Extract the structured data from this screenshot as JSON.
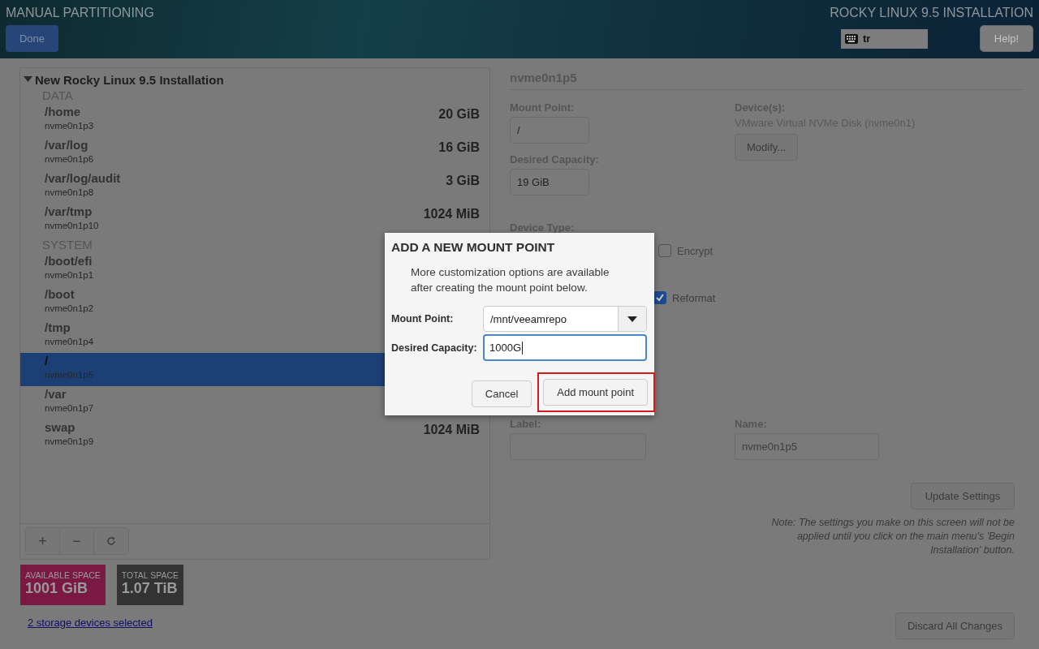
{
  "header": {
    "title": "MANUAL PARTITIONING",
    "done_button": "Done",
    "product": "ROCKY LINUX 9.5 INSTALLATION",
    "keyboard_layout": "tr",
    "help_button": "Help!"
  },
  "partitions": {
    "title": "New Rocky Linux 9.5 Installation",
    "expanded": true,
    "groups": [
      {
        "label": "DATA",
        "items": [
          {
            "mount": "/home",
            "device": "nvme0n1p3",
            "size": "20 GiB",
            "selected": false
          },
          {
            "mount": "/var/log",
            "device": "nvme0n1p6",
            "size": "16 GiB",
            "selected": false
          },
          {
            "mount": "/var/log/audit",
            "device": "nvme0n1p8",
            "size": "3 GiB",
            "selected": false
          },
          {
            "mount": "/var/tmp",
            "device": "nvme0n1p10",
            "size": "1024 MiB",
            "selected": false
          }
        ]
      },
      {
        "label": "SYSTEM",
        "items": [
          {
            "mount": "/boot/efi",
            "device": "nvme0n1p1",
            "selected": false
          },
          {
            "mount": "/boot",
            "device": "nvme0n1p2",
            "selected": false
          },
          {
            "mount": "/tmp",
            "device": "nvme0n1p4",
            "selected": false
          },
          {
            "mount": "/",
            "device": "nvme0n1p5",
            "selected": true
          },
          {
            "mount": "/var",
            "device": "nvme0n1p7",
            "selected": false
          },
          {
            "mount": "swap",
            "device": "nvme0n1p9",
            "size": "1024 MiB",
            "selected": false
          }
        ]
      }
    ],
    "toolbar": [
      "+",
      "−"
    ]
  },
  "space": [
    {
      "label": "AVAILABLE SPACE",
      "value": "1001 GiB",
      "color": "#7a1a44"
    },
    {
      "label": "TOTAL SPACE",
      "value": "1.07 TiB",
      "color": "#333333"
    }
  ],
  "storage_link": "2 storage devices selected",
  "details": {
    "title": "nvme0n1p5",
    "mount_point_label": "Mount Point:",
    "mount_point": "/",
    "capacity_label": "Desired Capacity:",
    "capacity": "19 GiB",
    "devices_label": "Device(s):",
    "devices": "VMware Virtual NVMe Disk (nvme0n1)",
    "modify_button": "Modify...",
    "device_type_label": "Device Type:",
    "encrypt": {
      "label": "Encrypt",
      "checked": false
    },
    "reformat": {
      "label": "Reformat",
      "checked": true
    },
    "label_label": "Label:",
    "name_label": "Name:",
    "name": "nvme0n1p5",
    "update_button": "Update Settings",
    "note": "Note:  The settings you make on this screen will not be applied until you click on the main menu's 'Begin Installation' button.",
    "discard_button": "Discard All Changes"
  },
  "dialog": {
    "title": "ADD A NEW MOUNT POINT",
    "message": "More customization options are available after creating the mount point below.",
    "mount_point_label": "Mount Point:",
    "mount_point": "/mnt/veeamrepo",
    "capacity_label": "Desired Capacity:",
    "capacity": "1000G",
    "buttons": [
      {
        "label": "Cancel",
        "highlighted": false
      },
      {
        "label": "Add mount point",
        "highlighted": true
      }
    ]
  }
}
